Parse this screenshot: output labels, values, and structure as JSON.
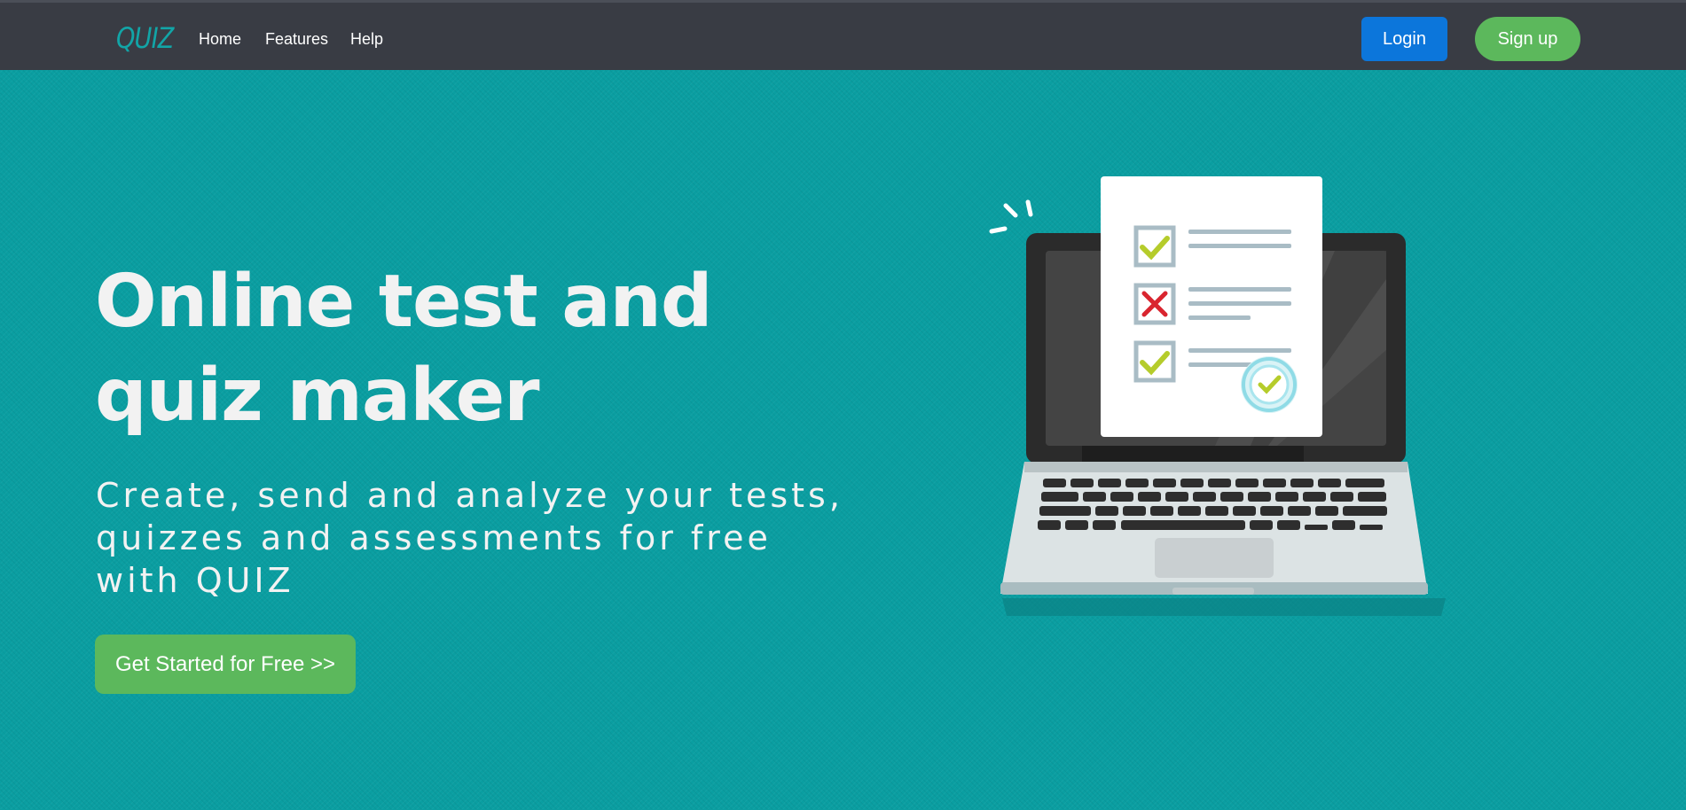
{
  "nav": {
    "logo": "QUIZ",
    "links": [
      "Home",
      "Features",
      "Help"
    ],
    "login": "Login",
    "signup": "Sign up"
  },
  "hero": {
    "title": "Online test and quiz maker",
    "subtitle": "Create, send and analyze your tests, quizzes and assessments for free with QUIZ",
    "cta": "Get Started for Free >>"
  },
  "illustration": {
    "name": "laptop-quiz-checklist-illustration",
    "items": [
      "check",
      "cross",
      "check"
    ]
  },
  "colors": {
    "background": "#0a9ea1",
    "navbar": "#393c44",
    "login": "#0c76db",
    "success": "#5cb85c",
    "check": "#b5cc2b",
    "cross": "#d9252f"
  }
}
